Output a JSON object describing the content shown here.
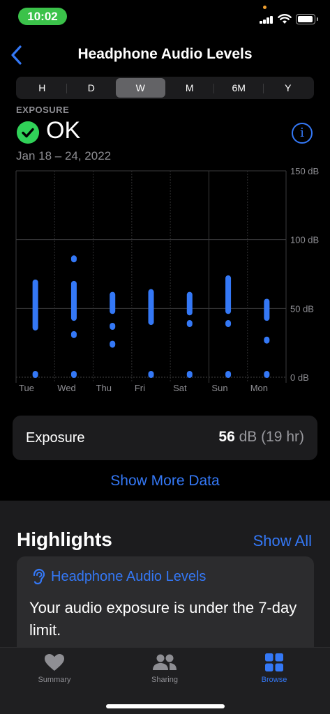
{
  "status_bar": {
    "time": "10:02"
  },
  "nav": {
    "title": "Headphone Audio Levels",
    "back_icon": "chevron-left-icon"
  },
  "segments": {
    "items": [
      "H",
      "D",
      "W",
      "M",
      "6M",
      "Y"
    ],
    "selected": "W"
  },
  "exposure": {
    "label": "EXPOSURE",
    "status": "OK",
    "date_range": "Jan 18 – 24, 2022"
  },
  "chart_data": {
    "type": "range",
    "categories": [
      "Tue",
      "Wed",
      "Thu",
      "Fri",
      "Sat",
      "Sun",
      "Mon"
    ],
    "y_ticks": [
      "150 dB",
      "100 dB",
      "50 dB",
      "0 dB"
    ],
    "ylim": [
      0,
      150
    ],
    "series_color": "#3478f6",
    "bars": [
      {
        "day": "Tue",
        "low": 36,
        "high": 69
      },
      {
        "day": "Wed",
        "low": 43,
        "high": 68
      },
      {
        "day": "Thu",
        "low": 48,
        "high": 60
      },
      {
        "day": "Fri",
        "low": 40,
        "high": 62
      },
      {
        "day": "Sat",
        "low": 47,
        "high": 60
      },
      {
        "day": "Sun",
        "low": 48,
        "high": 72
      },
      {
        "day": "Mon",
        "low": 43,
        "high": 55
      }
    ],
    "points": [
      {
        "day": "Tue",
        "value": 1
      },
      {
        "day": "Wed",
        "value": 86
      },
      {
        "day": "Wed",
        "value": 31
      },
      {
        "day": "Wed",
        "value": 1
      },
      {
        "day": "Thu",
        "value": 37
      },
      {
        "day": "Thu",
        "value": 24
      },
      {
        "day": "Fri",
        "value": 1
      },
      {
        "day": "Sat",
        "value": 39
      },
      {
        "day": "Sat",
        "value": 1
      },
      {
        "day": "Sun",
        "value": 39
      },
      {
        "day": "Sun",
        "value": 1
      },
      {
        "day": "Mon",
        "value": 27
      },
      {
        "day": "Mon",
        "value": 2
      }
    ],
    "reference_line": 100
  },
  "exposure_card": {
    "label": "Exposure",
    "value": "56",
    "unit": " dB (19 hr)"
  },
  "show_more": "Show More Data",
  "highlights": {
    "title": "Highlights",
    "show_all": "Show All",
    "card_title": "Headphone Audio Levels",
    "card_body": "Your audio exposure is under the 7-day limit."
  },
  "tabbar": {
    "items": [
      {
        "label": "Summary",
        "icon": "heart-icon",
        "active": false
      },
      {
        "label": "Sharing",
        "icon": "people-icon",
        "active": false
      },
      {
        "label": "Browse",
        "icon": "grid-icon",
        "active": true
      }
    ]
  },
  "colors": {
    "accent": "#3478f6",
    "ok_green": "#30d158",
    "status_green": "#3bc24a"
  }
}
